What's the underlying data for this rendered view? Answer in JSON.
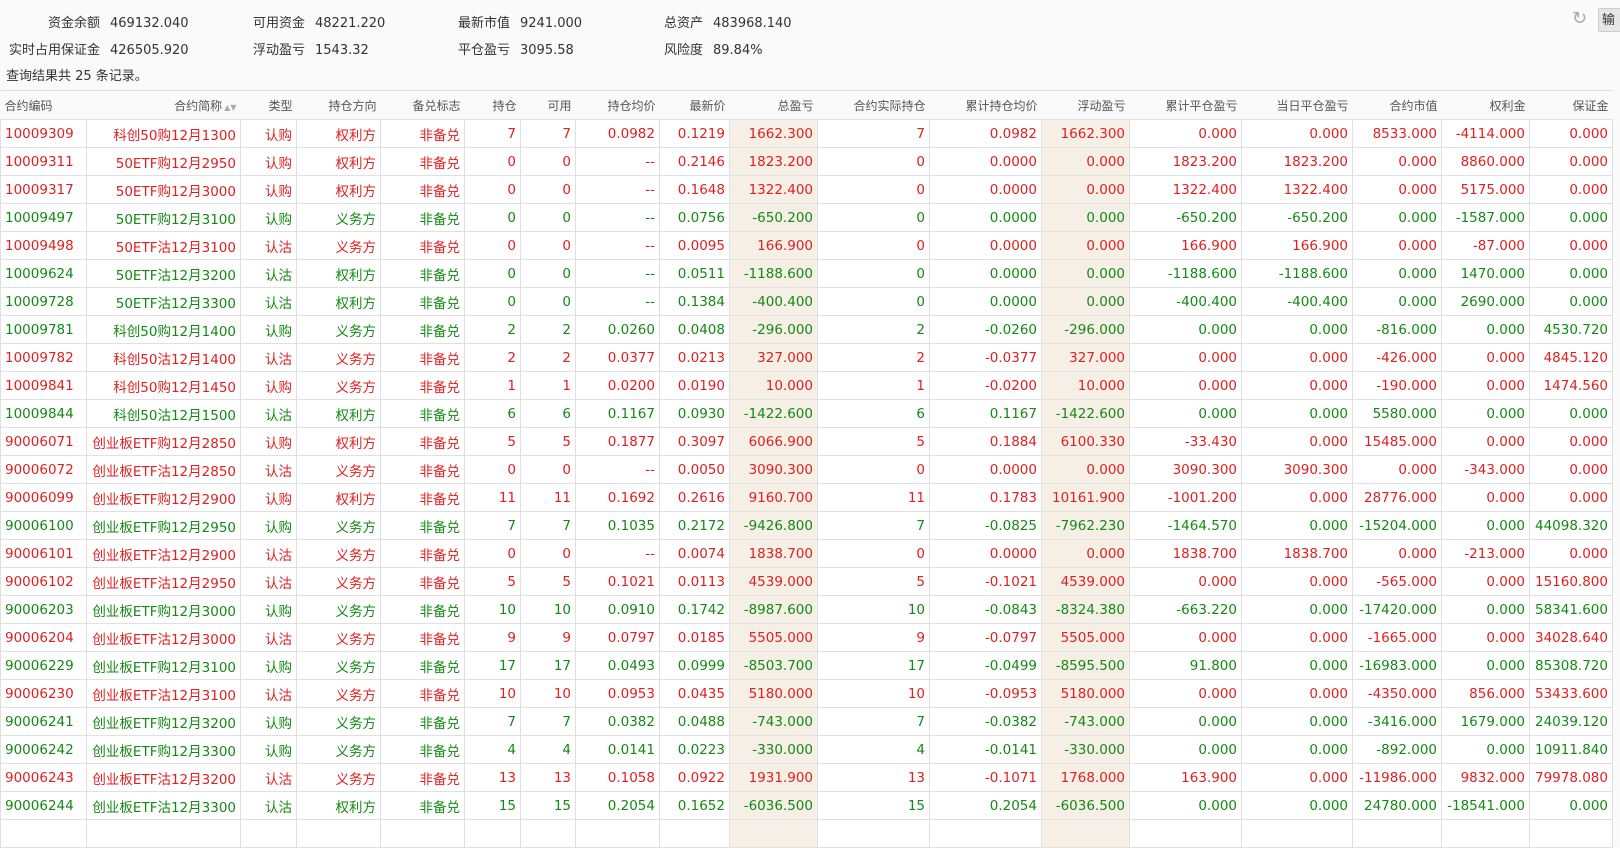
{
  "summary": [
    {
      "label": "资金余额",
      "value": "469132.040"
    },
    {
      "label": "可用资金",
      "value": "48221.220"
    },
    {
      "label": "最新市值",
      "value": "9241.000"
    },
    {
      "label": "总资产",
      "value": "483968.140"
    },
    {
      "label": "实时占用保证金",
      "value": "426505.920"
    },
    {
      "label": "浮动盈亏",
      "value": "1543.32"
    },
    {
      "label": "平仓盈亏",
      "value": "3095.58"
    },
    {
      "label": "风险度",
      "value": "89.84%"
    }
  ],
  "toolbar": {
    "refresh_icon": "refresh-icon",
    "export_label": "输"
  },
  "result_count": "查询结果共 25 条记录。",
  "colors": {
    "red": "#e02020",
    "green": "#138a13",
    "highlight_bg": "#f6efe6"
  },
  "columns": [
    "合约编码",
    "合约简称",
    "类型",
    "持仓方向",
    "备兑标志",
    "持仓",
    "可用",
    "持仓均价",
    "最新价",
    "总盈亏",
    "合约实际持仓",
    "累计持仓均价",
    "浮动盈亏",
    "累计平仓盈亏",
    "当日平仓盈亏",
    "合约市值",
    "权利金",
    "保证金"
  ],
  "sortable_column": "合约简称",
  "rows": [
    {
      "color": "red",
      "cells": [
        "10009309",
        "科创50购12月1300",
        "认购",
        "权利方",
        "非备兑",
        "7",
        "7",
        "0.0982",
        "0.1219",
        "1662.300",
        "7",
        "0.0982",
        "1662.300",
        "0.000",
        "0.000",
        "8533.000",
        "-4114.000",
        "0.000"
      ]
    },
    {
      "color": "red",
      "cells": [
        "10009311",
        "50ETF购12月2950",
        "认购",
        "权利方",
        "非备兑",
        "0",
        "0",
        "--",
        "0.2146",
        "1823.200",
        "0",
        "0.0000",
        "0.000",
        "1823.200",
        "1823.200",
        "0.000",
        "8860.000",
        "0.000"
      ]
    },
    {
      "color": "red",
      "cells": [
        "10009317",
        "50ETF购12月3000",
        "认购",
        "权利方",
        "非备兑",
        "0",
        "0",
        "--",
        "0.1648",
        "1322.400",
        "0",
        "0.0000",
        "0.000",
        "1322.400",
        "1322.400",
        "0.000",
        "5175.000",
        "0.000"
      ]
    },
    {
      "color": "green",
      "cells": [
        "10009497",
        "50ETF购12月3100",
        "认购",
        "义务方",
        "非备兑",
        "0",
        "0",
        "--",
        "0.0756",
        "-650.200",
        "0",
        "0.0000",
        "0.000",
        "-650.200",
        "-650.200",
        "0.000",
        "-1587.000",
        "0.000"
      ]
    },
    {
      "color": "red",
      "cells": [
        "10009498",
        "50ETF沽12月3100",
        "认沽",
        "义务方",
        "非备兑",
        "0",
        "0",
        "--",
        "0.0095",
        "166.900",
        "0",
        "0.0000",
        "0.000",
        "166.900",
        "166.900",
        "0.000",
        "-87.000",
        "0.000"
      ]
    },
    {
      "color": "green",
      "cells": [
        "10009624",
        "50ETF沽12月3200",
        "认沽",
        "权利方",
        "非备兑",
        "0",
        "0",
        "--",
        "0.0511",
        "-1188.600",
        "0",
        "0.0000",
        "0.000",
        "-1188.600",
        "-1188.600",
        "0.000",
        "1470.000",
        "0.000"
      ]
    },
    {
      "color": "green",
      "cells": [
        "10009728",
        "50ETF沽12月3300",
        "认沽",
        "权利方",
        "非备兑",
        "0",
        "0",
        "--",
        "0.1384",
        "-400.400",
        "0",
        "0.0000",
        "0.000",
        "-400.400",
        "-400.400",
        "0.000",
        "2690.000",
        "0.000"
      ]
    },
    {
      "color": "green",
      "cells": [
        "10009781",
        "科创50购12月1400",
        "认购",
        "义务方",
        "非备兑",
        "2",
        "2",
        "0.0260",
        "0.0408",
        "-296.000",
        "2",
        "-0.0260",
        "-296.000",
        "0.000",
        "0.000",
        "-816.000",
        "0.000",
        "4530.720"
      ]
    },
    {
      "color": "red",
      "cells": [
        "10009782",
        "科创50沽12月1400",
        "认沽",
        "义务方",
        "非备兑",
        "2",
        "2",
        "0.0377",
        "0.0213",
        "327.000",
        "2",
        "-0.0377",
        "327.000",
        "0.000",
        "0.000",
        "-426.000",
        "0.000",
        "4845.120"
      ]
    },
    {
      "color": "red",
      "cells": [
        "10009841",
        "科创50购12月1450",
        "认购",
        "义务方",
        "非备兑",
        "1",
        "1",
        "0.0200",
        "0.0190",
        "10.000",
        "1",
        "-0.0200",
        "10.000",
        "0.000",
        "0.000",
        "-190.000",
        "0.000",
        "1474.560"
      ]
    },
    {
      "color": "green",
      "cells": [
        "10009844",
        "科创50沽12月1500",
        "认沽",
        "权利方",
        "非备兑",
        "6",
        "6",
        "0.1167",
        "0.0930",
        "-1422.600",
        "6",
        "0.1167",
        "-1422.600",
        "0.000",
        "0.000",
        "5580.000",
        "0.000",
        "0.000"
      ]
    },
    {
      "color": "red",
      "cells": [
        "90006071",
        "创业板ETF购12月2850",
        "认购",
        "权利方",
        "非备兑",
        "5",
        "5",
        "0.1877",
        "0.3097",
        "6066.900",
        "5",
        "0.1884",
        "6100.330",
        "-33.430",
        "0.000",
        "15485.000",
        "0.000",
        "0.000"
      ]
    },
    {
      "color": "red",
      "cells": [
        "90006072",
        "创业板ETF沽12月2850",
        "认沽",
        "义务方",
        "非备兑",
        "0",
        "0",
        "--",
        "0.0050",
        "3090.300",
        "0",
        "0.0000",
        "0.000",
        "3090.300",
        "3090.300",
        "0.000",
        "-343.000",
        "0.000"
      ]
    },
    {
      "color": "red",
      "cells": [
        "90006099",
        "创业板ETF购12月2900",
        "认购",
        "权利方",
        "非备兑",
        "11",
        "11",
        "0.1692",
        "0.2616",
        "9160.700",
        "11",
        "0.1783",
        "10161.900",
        "-1001.200",
        "0.000",
        "28776.000",
        "0.000",
        "0.000"
      ]
    },
    {
      "color": "green",
      "cells": [
        "90006100",
        "创业板ETF购12月2950",
        "认购",
        "义务方",
        "非备兑",
        "7",
        "7",
        "0.1035",
        "0.2172",
        "-9426.800",
        "7",
        "-0.0825",
        "-7962.230",
        "-1464.570",
        "0.000",
        "-15204.000",
        "0.000",
        "44098.320"
      ]
    },
    {
      "color": "red",
      "cells": [
        "90006101",
        "创业板ETF沽12月2900",
        "认沽",
        "义务方",
        "非备兑",
        "0",
        "0",
        "--",
        "0.0074",
        "1838.700",
        "0",
        "0.0000",
        "0.000",
        "1838.700",
        "1838.700",
        "0.000",
        "-213.000",
        "0.000"
      ]
    },
    {
      "color": "red",
      "cells": [
        "90006102",
        "创业板ETF沽12月2950",
        "认沽",
        "义务方",
        "非备兑",
        "5",
        "5",
        "0.1021",
        "0.0113",
        "4539.000",
        "5",
        "-0.1021",
        "4539.000",
        "0.000",
        "0.000",
        "-565.000",
        "0.000",
        "15160.800"
      ]
    },
    {
      "color": "green",
      "cells": [
        "90006203",
        "创业板ETF购12月3000",
        "认购",
        "义务方",
        "非备兑",
        "10",
        "10",
        "0.0910",
        "0.1742",
        "-8987.600",
        "10",
        "-0.0843",
        "-8324.380",
        "-663.220",
        "0.000",
        "-17420.000",
        "0.000",
        "58341.600"
      ]
    },
    {
      "color": "red",
      "cells": [
        "90006204",
        "创业板ETF沽12月3000",
        "认沽",
        "义务方",
        "非备兑",
        "9",
        "9",
        "0.0797",
        "0.0185",
        "5505.000",
        "9",
        "-0.0797",
        "5505.000",
        "0.000",
        "0.000",
        "-1665.000",
        "0.000",
        "34028.640"
      ]
    },
    {
      "color": "green",
      "cells": [
        "90006229",
        "创业板ETF购12月3100",
        "认购",
        "义务方",
        "非备兑",
        "17",
        "17",
        "0.0493",
        "0.0999",
        "-8503.700",
        "17",
        "-0.0499",
        "-8595.500",
        "91.800",
        "0.000",
        "-16983.000",
        "0.000",
        "85308.720"
      ]
    },
    {
      "color": "red",
      "cells": [
        "90006230",
        "创业板ETF沽12月3100",
        "认沽",
        "义务方",
        "非备兑",
        "10",
        "10",
        "0.0953",
        "0.0435",
        "5180.000",
        "10",
        "-0.0953",
        "5180.000",
        "0.000",
        "0.000",
        "-4350.000",
        "856.000",
        "53433.600"
      ]
    },
    {
      "color": "green",
      "cells": [
        "90006241",
        "创业板ETF购12月3200",
        "认购",
        "义务方",
        "非备兑",
        "7",
        "7",
        "0.0382",
        "0.0488",
        "-743.000",
        "7",
        "-0.0382",
        "-743.000",
        "0.000",
        "0.000",
        "-3416.000",
        "1679.000",
        "24039.120"
      ]
    },
    {
      "color": "green",
      "cells": [
        "90006242",
        "创业板ETF购12月3300",
        "认购",
        "义务方",
        "非备兑",
        "4",
        "4",
        "0.0141",
        "0.0223",
        "-330.000",
        "4",
        "-0.0141",
        "-330.000",
        "0.000",
        "0.000",
        "-892.000",
        "0.000",
        "10911.840"
      ]
    },
    {
      "color": "red",
      "cells": [
        "90006243",
        "创业板ETF沽12月3200",
        "认沽",
        "义务方",
        "非备兑",
        "13",
        "13",
        "0.1058",
        "0.0922",
        "1931.900",
        "13",
        "-0.1071",
        "1768.000",
        "163.900",
        "0.000",
        "-11986.000",
        "9832.000",
        "79978.080"
      ]
    },
    {
      "color": "green",
      "cells": [
        "90006244",
        "创业板ETF沽12月3300",
        "认沽",
        "权利方",
        "非备兑",
        "15",
        "15",
        "0.2054",
        "0.1652",
        "-6036.500",
        "15",
        "0.2054",
        "-6036.500",
        "0.000",
        "0.000",
        "24780.000",
        "-18541.000",
        "0.000"
      ]
    }
  ]
}
